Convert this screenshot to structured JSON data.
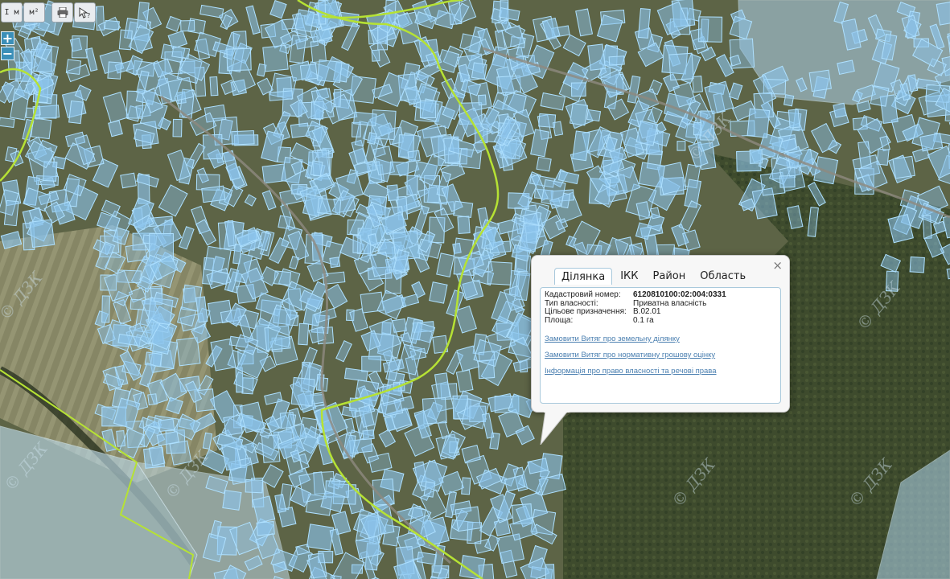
{
  "toolbar": {
    "tools": [
      {
        "name": "measure-line-tool",
        "label": "І м"
      },
      {
        "name": "measure-area-tool",
        "label": "м²"
      },
      {
        "name": "print-button",
        "icon": "printer-icon"
      },
      {
        "name": "identify-button",
        "icon": "pointer-question-icon"
      }
    ]
  },
  "zoom": {
    "in_label": "+",
    "out_label": "−"
  },
  "popup": {
    "tabs": [
      "Ділянка",
      "ІКК",
      "Район",
      "Область"
    ],
    "active_tab": 0,
    "rows": [
      {
        "key": "Кадастровий номер:",
        "value": "6120810100:02:004:0331"
      },
      {
        "key": "Тип власності:",
        "value": "Приватна власність"
      },
      {
        "key": "Цільове призначення:",
        "value": "В.02.01"
      },
      {
        "key": "Площа:",
        "value": "0.1 га"
      }
    ],
    "links": [
      "Замовити Витяг про земельну ділянку",
      "Замовити Витяг про нормативну грошову оцінку",
      "Інформація про право власності та речові права"
    ],
    "close": "×"
  },
  "map": {
    "watermark": "© ДЗК",
    "colors": {
      "parcel_fill": "#8cc4ec",
      "parcel_stroke": "#aee0ff",
      "boundary": "#b6e234",
      "forest": "#3c4a2a"
    }
  }
}
